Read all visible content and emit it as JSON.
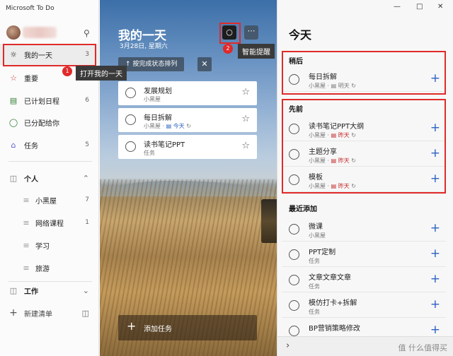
{
  "app": {
    "title": "Microsoft To Do"
  },
  "sidebar": {
    "items": [
      {
        "label": "我的一天",
        "count": "3",
        "icon": "sun-icon"
      },
      {
        "label": "重要",
        "count": "",
        "icon": "star-icon"
      },
      {
        "label": "已计划日程",
        "count": "6",
        "icon": "calendar-icon"
      },
      {
        "label": "已分配给你",
        "count": "",
        "icon": "person-icon"
      },
      {
        "label": "任务",
        "count": "5",
        "icon": "home-icon"
      }
    ],
    "group_personal": "个人",
    "sub_items": [
      {
        "label": "小黑屋",
        "count": "7"
      },
      {
        "label": "网络课程",
        "count": "1"
      },
      {
        "label": "学习",
        "count": ""
      },
      {
        "label": "旅游",
        "count": ""
      }
    ],
    "group_work": "工作",
    "new_list": "新建清单"
  },
  "middle": {
    "title": "我的一天",
    "date": "3月28日, 星期六",
    "sort_label": "按完成状态排列",
    "tasks": [
      {
        "title": "发展规划",
        "sub": "小黑屋",
        "tag": ""
      },
      {
        "title": "每日拆解",
        "sub": "小黑屋 · ",
        "tag": "今天"
      },
      {
        "title": "读书笔记PPT",
        "sub": "任务",
        "tag": ""
      }
    ],
    "add_task": "添加任务"
  },
  "right": {
    "title": "今天",
    "later": {
      "title": "稍后",
      "tasks": [
        {
          "title": "每日拆解",
          "sub": "小黑屋 · ",
          "tag": "明天"
        }
      ]
    },
    "earlier": {
      "title": "先前",
      "tasks": [
        {
          "title": "读书笔记PPT大纲",
          "sub": "小黑屋 · ",
          "tag": "昨天"
        },
        {
          "title": "主题分享",
          "sub": "小黑屋 · ",
          "tag": "昨天"
        },
        {
          "title": "模板",
          "sub": "小黑屋 · ",
          "tag": "昨天"
        }
      ]
    },
    "recent": {
      "title": "最近添加",
      "tasks": [
        {
          "title": "微课",
          "sub": "小黑屋"
        },
        {
          "title": "PPT定制",
          "sub": "任务"
        },
        {
          "title": "文章文章文章",
          "sub": "任务"
        },
        {
          "title": "模仿打卡+拆解",
          "sub": "任务"
        },
        {
          "title": "BP营销策略修改",
          "sub": ""
        }
      ]
    }
  },
  "annotations": {
    "badge1": "1",
    "callout1": "打开我的一天",
    "badge2": "2",
    "callout2": "智能提醒"
  },
  "watermark": "值 什么值得买",
  "colors": {
    "accent": "#2d62c2",
    "annotation": "#e02a2a",
    "overdue": "#c62828"
  }
}
